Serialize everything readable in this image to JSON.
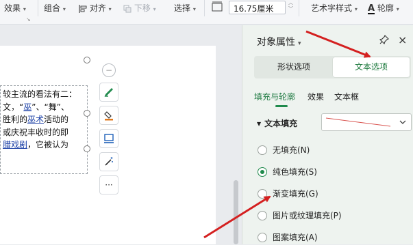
{
  "ribbon": {
    "effects_label": "效果",
    "group_label": "组合",
    "align_label": "对齐",
    "move_down_label": "下移",
    "select_label": "选择",
    "width_value": "16.75厘米",
    "art_style_label": "艺术字样式",
    "outline_label": "轮廓",
    "accent_color": "#c0392b"
  },
  "document": {
    "lines": [
      {
        "text": "较主流的看法有二："
      },
      {
        "before": "文，“",
        "link": "巫",
        "after": "”、“舞”、"
      },
      {
        "before": "胜利的",
        "link": "巫术",
        "after": "活动的"
      },
      {
        "text": "或庆祝丰收时的即"
      },
      {
        "before": "",
        "link": "腊戏剧",
        "after": "，它被认为"
      }
    ],
    "toolbar_icons": [
      "minus-icon",
      "pen-icon",
      "fill-bucket-icon",
      "layout-icon",
      "magic-wand-icon",
      "more-icon"
    ],
    "more_label": "···"
  },
  "panel": {
    "title": "对象属性",
    "close_label": "×",
    "tabs": {
      "shape": "形状选项",
      "text": "文本选项"
    },
    "subtabs": {
      "fill_outline": "填充与轮廓",
      "effects": "效果",
      "textbox": "文本框"
    },
    "section_label": "文本填充",
    "fill_options": [
      {
        "label": "无填充(N)",
        "selected": false
      },
      {
        "label": "纯色填充(S)",
        "selected": true
      },
      {
        "label": "渐变填充(G)",
        "selected": false
      },
      {
        "label": "图片或纹理填充(P)",
        "selected": false
      },
      {
        "label": "图案填充(A)",
        "selected": false
      }
    ],
    "active_color": "#1f8a4c"
  },
  "annotation_color": "#d42020"
}
